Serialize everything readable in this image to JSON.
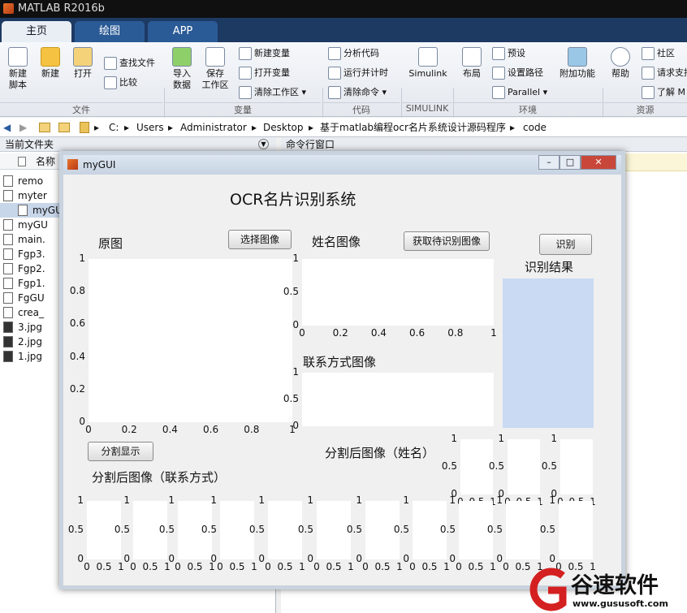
{
  "app": {
    "title": "MATLAB R2016b"
  },
  "tabs": [
    "主页",
    "绘图",
    "APP"
  ],
  "ribbon": {
    "new_script": "新建\n脚本",
    "new": "新建",
    "open": "打开",
    "find_files": "查找文件",
    "compare": "比较",
    "import": "导入\n数据",
    "save_ws": "保存\n工作区",
    "new_var": "新建变量",
    "open_var": "打开变量",
    "clear_ws": "清除工作区",
    "analyze": "分析代码",
    "run_time": "运行并计时",
    "clear_cmd": "清除命令",
    "simulink": "Simulink",
    "layout": "布局",
    "prefs": "预设",
    "set_path": "设置路径",
    "parallel": "Parallel",
    "addons": "附加功能",
    "help": "帮助",
    "community": "社区",
    "request": "请求支持",
    "learn": "了解 M",
    "groups": [
      "文件",
      "变量",
      "代码",
      "SIMULINK",
      "环境",
      "资源"
    ]
  },
  "address": {
    "parts": [
      "C:",
      "Users",
      "Administrator",
      "Desktop",
      "基于matlab编程ocr名片系统设计源码程序",
      "code"
    ]
  },
  "files_panel": {
    "title": "当前文件夹",
    "col": "名称",
    "items": [
      "remo",
      "myter",
      "myGU",
      "myGU",
      "main.",
      "Fgp3.",
      "Fgp2.",
      "Fgp1.",
      "FgGU",
      "crea_",
      "3.jpg",
      "2.jpg",
      "1.jpg"
    ]
  },
  "cmd_panel": {
    "title": "命令行窗口"
  },
  "gui": {
    "title": "myGUI",
    "heading": "OCR名片识别系统",
    "orig_label": "原图",
    "select_btn": "选择图像",
    "name_label": "姓名图像",
    "get_btn": "获取待识别图像",
    "recog_btn": "识别",
    "result_label": "识别结果",
    "contact_label": "联系方式图像",
    "split_btn": "分割显示",
    "seg_name_label": "分割后图像（姓名）",
    "seg_contact_label": "分割后图像（联系方式）",
    "ticks": {
      "y01": [
        "1",
        "0.8",
        "0.6",
        "0.4",
        "0.2",
        "0"
      ],
      "x01": [
        "0",
        "0.2",
        "0.4",
        "0.6",
        "0.8",
        "1"
      ],
      "y3": [
        "1",
        "0.5",
        "0"
      ],
      "x3": [
        "0",
        "0.5",
        "1"
      ]
    }
  },
  "watermark": {
    "name": "谷速软件",
    "url": "www.gususoft.com"
  }
}
